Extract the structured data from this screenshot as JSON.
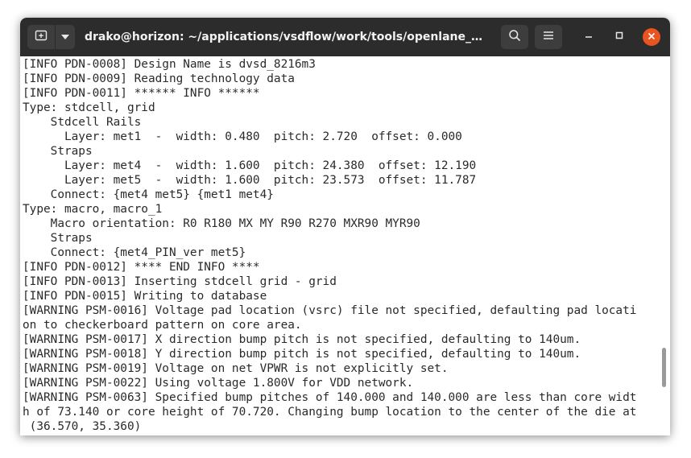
{
  "window": {
    "title": "drako@horizon: ~/applications/vsdflow/work/tools/openlane_worki..."
  },
  "colors": {
    "titlebar": "#2c2c2c",
    "button": "#3d3d3d",
    "close": "#e95420",
    "terminal_bg": "#ffffff",
    "terminal_fg": "#2a2a2a"
  },
  "icons": {
    "new_tab": "new-tab-icon",
    "dropdown": "chevron-down-icon",
    "search": "search-icon",
    "menu": "hamburger-menu-icon",
    "minimize": "minimize-icon",
    "maximize": "maximize-icon",
    "close": "close-icon"
  },
  "terminal": {
    "lines": [
      "[INFO PDN-0008] Design Name is dvsd_8216m3",
      "[INFO PDN-0009] Reading technology data",
      "[INFO PDN-0011] ****** INFO ******",
      "Type: stdcell, grid",
      "    Stdcell Rails",
      "      Layer: met1  -  width: 0.480  pitch: 2.720  offset: 0.000",
      "    Straps",
      "      Layer: met4  -  width: 1.600  pitch: 24.380  offset: 12.190",
      "      Layer: met5  -  width: 1.600  pitch: 23.573  offset: 11.787",
      "    Connect: {met4 met5} {met1 met4}",
      "Type: macro, macro_1",
      "    Macro orientation: R0 R180 MX MY R90 R270 MXR90 MYR90",
      "    Straps",
      "    Connect: {met4_PIN_ver met5}",
      "[INFO PDN-0012] **** END INFO ****",
      "[INFO PDN-0013] Inserting stdcell grid - grid",
      "[INFO PDN-0015] Writing to database",
      "[WARNING PSM-0016] Voltage pad location (vsrc) file not specified, defaulting pad locati",
      "on to checkerboard pattern on core area.",
      "[WARNING PSM-0017] X direction bump pitch is not specified, defaulting to 140um.",
      "[WARNING PSM-0018] Y direction bump pitch is not specified, defaulting to 140um.",
      "[WARNING PSM-0019] Voltage on net VPWR is not explicitly set.",
      "[WARNING PSM-0022] Using voltage 1.800V for VDD network.",
      "[WARNING PSM-0063] Specified bump pitches of 140.000 and 140.000 are less than core widt",
      "h of 73.140 or core height of 70.720. Changing bump location to the center of the die at",
      " (36.570, 35.360)"
    ]
  }
}
